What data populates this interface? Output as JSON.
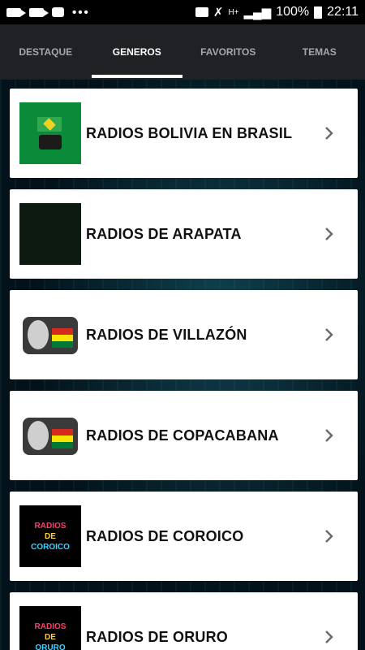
{
  "status_bar": {
    "battery_text": "100%",
    "time": "22:11",
    "network": "H+",
    "dots": "•••"
  },
  "tabs": [
    {
      "label": "DESTAQUE",
      "active": false
    },
    {
      "label": "GENEROS",
      "active": true
    },
    {
      "label": "FAVORITOS",
      "active": false
    },
    {
      "label": "TEMAS",
      "active": false
    }
  ],
  "items": [
    {
      "label": "RADIOS BOLIVIA EN BRASIL",
      "thumb": "brasil"
    },
    {
      "label": "RADIOS DE ARAPATA",
      "thumb": "arapata"
    },
    {
      "label": "RADIOS DE VILLAZÓN",
      "thumb": "radio"
    },
    {
      "label": "RADIOS DE COPACABANA",
      "thumb": "radio"
    },
    {
      "label": "RADIOS DE COROICO",
      "thumb": "text",
      "thumb_text": [
        "RADIOS",
        "DE",
        "COROICO"
      ]
    },
    {
      "label": "RADIOS DE ORURO",
      "thumb": "text",
      "thumb_text": [
        "RADIOS",
        "DE",
        "ORURO"
      ]
    }
  ],
  "colors": {
    "tab_bg": "#1f2125",
    "active_tab": "#ffffff",
    "inactive_tab": "#a5a7aa"
  }
}
